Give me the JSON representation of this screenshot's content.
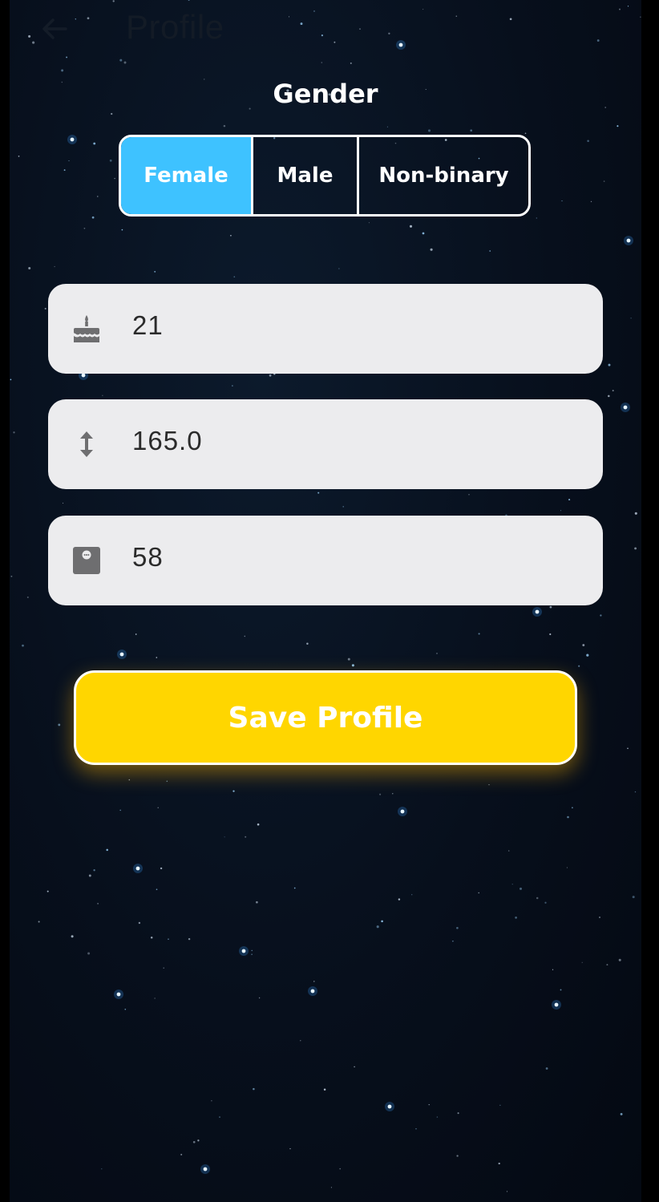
{
  "appbar": {
    "title": "Profile",
    "back_icon": "arrow-left-icon"
  },
  "gender": {
    "label": "Gender",
    "options": [
      "Female",
      "Male",
      "Non-binary"
    ],
    "selected": "Female",
    "selected_color": "#3ec2ff"
  },
  "fields": {
    "age": {
      "value": "21",
      "icon": "birthday-cake-icon"
    },
    "height": {
      "value": "165.0",
      "icon": "vertical-arrows-icon"
    },
    "weight": {
      "value": "58",
      "icon": "weight-scale-icon"
    }
  },
  "save_button": {
    "label": "Save Profile",
    "color": "#ffd600"
  },
  "background": "starry-night-sky"
}
